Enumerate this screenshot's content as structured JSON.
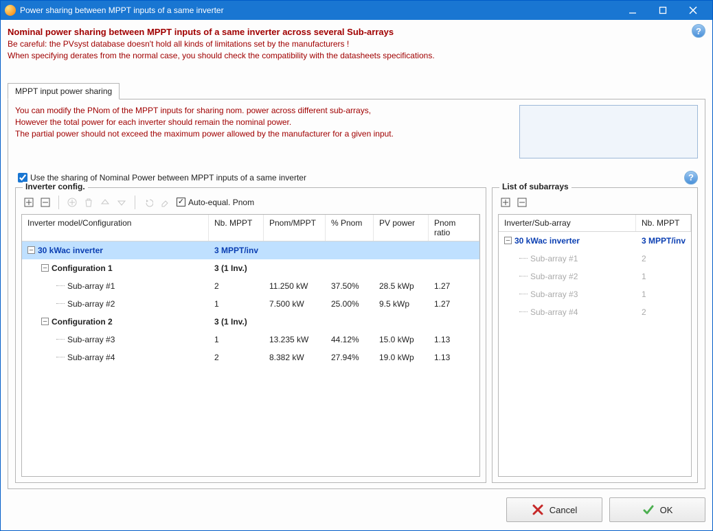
{
  "window": {
    "title": "Power sharing between MPPT inputs of a same inverter"
  },
  "header": {
    "heading": "Nominal power sharing between MPPT inputs of a same inverter across several Sub-arrays",
    "line1": "Be careful: the PVsyst database doesn't hold all kinds of limitations set by the manufacturers !",
    "line2": "When specifying derates from the normal case, you should check the compatibility with the datasheets specifications."
  },
  "tab": {
    "label": "MPPT input power sharing"
  },
  "note": {
    "l1": "You can modify the PNom of the MPPT inputs for sharing nom. power across different sub-arrays,",
    "l2": "However the total power for each inverter should remain the nominal power.",
    "l3": "The partial power should not exceed the maximum power allowed by the manufacturer for a given input."
  },
  "checkbox": {
    "label": "Use the sharing of Nominal Power between MPPT inputs of a same inverter",
    "checked": true
  },
  "left": {
    "legend": "Inverter config.",
    "autoeq": "Auto-equal. Pnom",
    "cols": {
      "c0": "Inverter model/Configuration",
      "c1": "Nb. MPPT",
      "c2": "Pnom/MPPT",
      "c3": "% Pnom",
      "c4": "PV power",
      "c5": "Pnom ratio"
    },
    "inv": {
      "name": "30 kWac inverter",
      "mppt": "3 MPPT/inv"
    },
    "cfg1": {
      "name": "Configuration 1",
      "mppt": "3 (1 Inv.)"
    },
    "sa1": {
      "name": "Sub-array #1",
      "mppt": "2",
      "pnom": "11.250 kW",
      "pct": "37.50%",
      "pv": "28.5 kWp",
      "ratio": "1.27"
    },
    "sa2": {
      "name": "Sub-array #2",
      "mppt": "1",
      "pnom": "7.500 kW",
      "pct": "25.00%",
      "pv": "9.5 kWp",
      "ratio": "1.27"
    },
    "cfg2": {
      "name": "Configuration 2",
      "mppt": "3 (1 Inv.)"
    },
    "sa3": {
      "name": "Sub-array #3",
      "mppt": "1",
      "pnom": "13.235 kW",
      "pct": "44.12%",
      "pv": "15.0 kWp",
      "ratio": "1.13"
    },
    "sa4": {
      "name": "Sub-array #4",
      "mppt": "2",
      "pnom": "8.382 kW",
      "pct": "27.94%",
      "pv": "19.0 kWp",
      "ratio": "1.13"
    }
  },
  "right": {
    "legend": "List of subarrays",
    "cols": {
      "c0": "Inverter/Sub-array",
      "c1": "Nb. MPPT"
    },
    "inv": {
      "name": "30 kWac inverter",
      "mppt": "3 MPPT/inv"
    },
    "sa1": {
      "name": "Sub-array #1",
      "mppt": "2"
    },
    "sa2": {
      "name": "Sub-array #2",
      "mppt": "1"
    },
    "sa3": {
      "name": "Sub-array #3",
      "mppt": "1"
    },
    "sa4": {
      "name": "Sub-array #4",
      "mppt": "2"
    }
  },
  "buttons": {
    "cancel": "Cancel",
    "ok": "OK"
  }
}
